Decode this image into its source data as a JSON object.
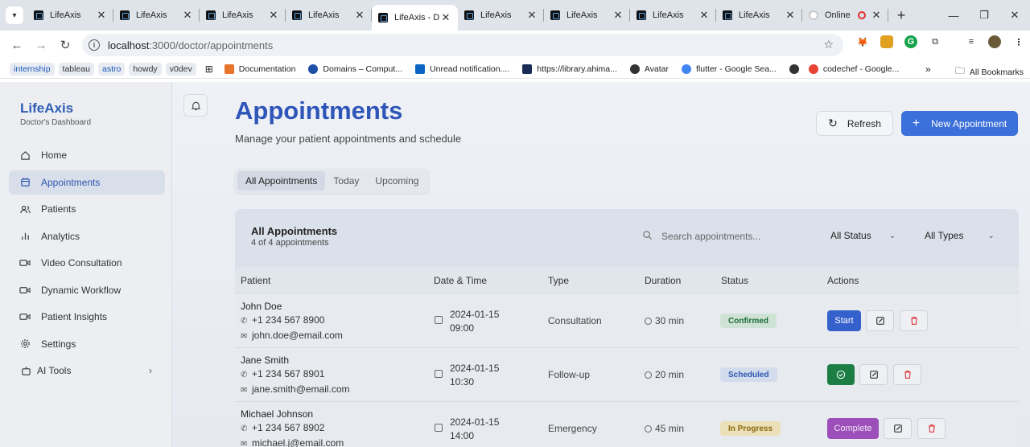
{
  "browser": {
    "tabs": [
      {
        "title": "LifeAxis",
        "active": false
      },
      {
        "title": "LifeAxis",
        "active": false
      },
      {
        "title": "LifeAxis",
        "active": false
      },
      {
        "title": "LifeAxis",
        "active": false
      },
      {
        "title": "LifeAxis - D",
        "active": true
      },
      {
        "title": "LifeAxis",
        "active": false
      },
      {
        "title": "LifeAxis",
        "active": false
      },
      {
        "title": "LifeAxis",
        "active": false
      },
      {
        "title": "LifeAxis",
        "active": false
      },
      {
        "title": "Online",
        "active": false
      }
    ],
    "url_host": "localhost",
    "url_path": ":3000/doctor/appointments",
    "bookmark_chips": [
      "internship",
      "tableau",
      "astro",
      "howdy",
      "v0dev"
    ],
    "bookmarks": [
      "Documentation",
      "Domains – Comput...",
      "Unread notification....",
      "https://library.ahima...",
      "Avatar",
      "flutter - Google Sea...",
      "codechef - Google..."
    ],
    "all_bookmarks": "All Bookmarks"
  },
  "sidebar": {
    "brand": "LifeAxis",
    "subtitle": "Doctor's Dashboard",
    "items": [
      {
        "label": "Home",
        "icon": "home-icon"
      },
      {
        "label": "Appointments",
        "icon": "calendar-icon"
      },
      {
        "label": "Patients",
        "icon": "users-icon"
      },
      {
        "label": "Analytics",
        "icon": "bar-chart-icon"
      },
      {
        "label": "Video Consultation",
        "icon": "video-icon"
      },
      {
        "label": "Dynamic Workflow",
        "icon": "video-icon"
      },
      {
        "label": "Patient Insights",
        "icon": "video-icon"
      },
      {
        "label": "Settings",
        "icon": "gear-icon"
      },
      {
        "label": "AI Tools",
        "icon": "bot-icon"
      }
    ]
  },
  "header": {
    "title": "Appointments",
    "subtitle": "Manage your patient appointments and schedule",
    "refresh_label": "Refresh",
    "new_label": "New Appointment"
  },
  "filter_tabs": [
    "All Appointments",
    "Today",
    "Upcoming"
  ],
  "card": {
    "title": "All Appointments",
    "count": "4 of 4 appointments",
    "search_placeholder": "Search appointments...",
    "status_filter": "All Status",
    "type_filter": "All Types"
  },
  "table": {
    "columns": [
      "Patient",
      "Date & Time",
      "Type",
      "Duration",
      "Status",
      "Actions"
    ],
    "rows": [
      {
        "name": "John Doe",
        "phone": "+1 234 567 8900",
        "email": "john.doe@email.com",
        "date": "2024-01-15",
        "time": "09:00",
        "type": "Consultation",
        "duration": "30 min",
        "status": "Confirmed",
        "action": "Start"
      },
      {
        "name": "Jane Smith",
        "phone": "+1 234 567 8901",
        "email": "jane.smith@email.com",
        "date": "2024-01-15",
        "time": "10:30",
        "type": "Follow-up",
        "duration": "20 min",
        "status": "Scheduled",
        "action": ""
      },
      {
        "name": "Michael Johnson",
        "phone": "+1 234 567 8902",
        "email": "michael.j@email.com",
        "date": "2024-01-15",
        "time": "14:00",
        "type": "Emergency",
        "duration": "45 min",
        "status": "In Progress",
        "action": "Complete"
      }
    ]
  },
  "colors": {
    "brand": "#2e5db3",
    "primary_button": "#3b6fd9",
    "confirmed_bg": "#cfe3d4",
    "scheduled_bg": "#d3dcec",
    "in_progress_bg": "#ece0b8",
    "start_button": "#3561cc",
    "check_button": "#1c7d45",
    "complete_button": "#9c4fb8"
  }
}
